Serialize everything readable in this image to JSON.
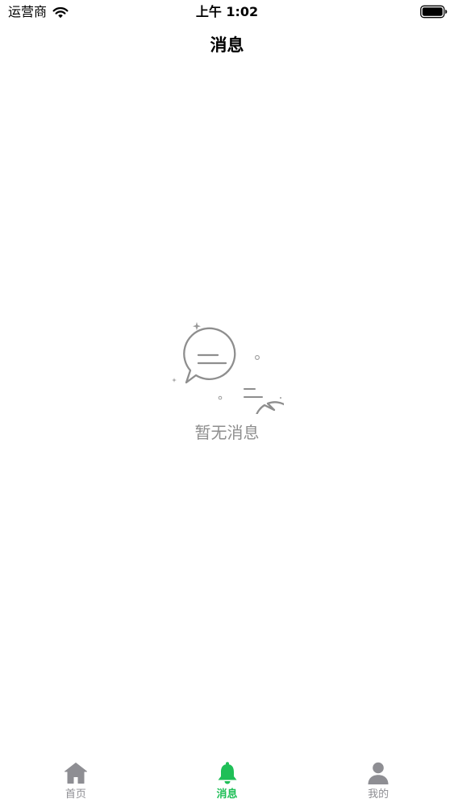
{
  "status_bar": {
    "carrier": "运营商",
    "time": "上午 1:02",
    "wifi_icon": "wifi-icon",
    "battery_icon": "battery-full-icon"
  },
  "nav": {
    "title": "消息"
  },
  "empty_state": {
    "icon": "chat-bubbles-icon",
    "text": "暂无消息"
  },
  "tab_bar": {
    "accent_color": "#1fbf57",
    "inactive_color": "#8e8e93",
    "tabs": [
      {
        "label": "首页",
        "icon": "home-icon",
        "active": false
      },
      {
        "label": "消息",
        "icon": "bell-icon",
        "active": true
      },
      {
        "label": "我的",
        "icon": "person-icon",
        "active": false
      }
    ]
  }
}
